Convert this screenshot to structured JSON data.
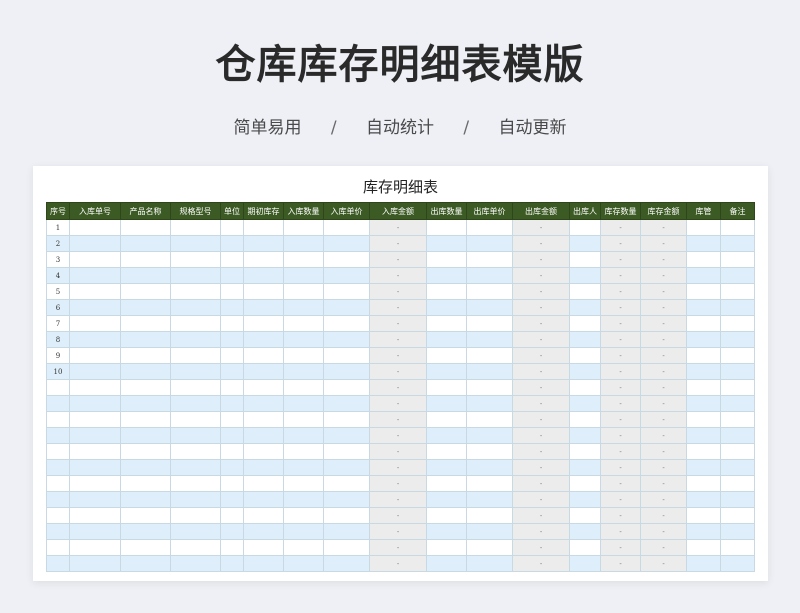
{
  "page": {
    "title": "仓库库存明细表模版",
    "tags": [
      "简单易用",
      "自动统计",
      "自动更新"
    ],
    "separator": "/"
  },
  "sheet": {
    "title": "库存明细表",
    "columns": [
      "序号",
      "入库单号",
      "产品名称",
      "规格型号",
      "单位",
      "期初库存",
      "入库数量",
      "入库单价",
      "入库金额",
      "出库数量",
      "出库单价",
      "出库金额",
      "出库人",
      "库存数量",
      "库存金额",
      "库管",
      "备注"
    ],
    "calc_columns": [
      8,
      11,
      13,
      14
    ],
    "calc_placeholder": "-",
    "serial_numbers": [
      "1",
      "2",
      "3",
      "4",
      "5",
      "6",
      "7",
      "8",
      "9",
      "10"
    ],
    "row_count": 22
  },
  "colors": {
    "header_bg": "#3c5a24",
    "row_alt": "#deeefa",
    "calc_cell": "#ececec",
    "page_bg": "#eef0f5"
  }
}
